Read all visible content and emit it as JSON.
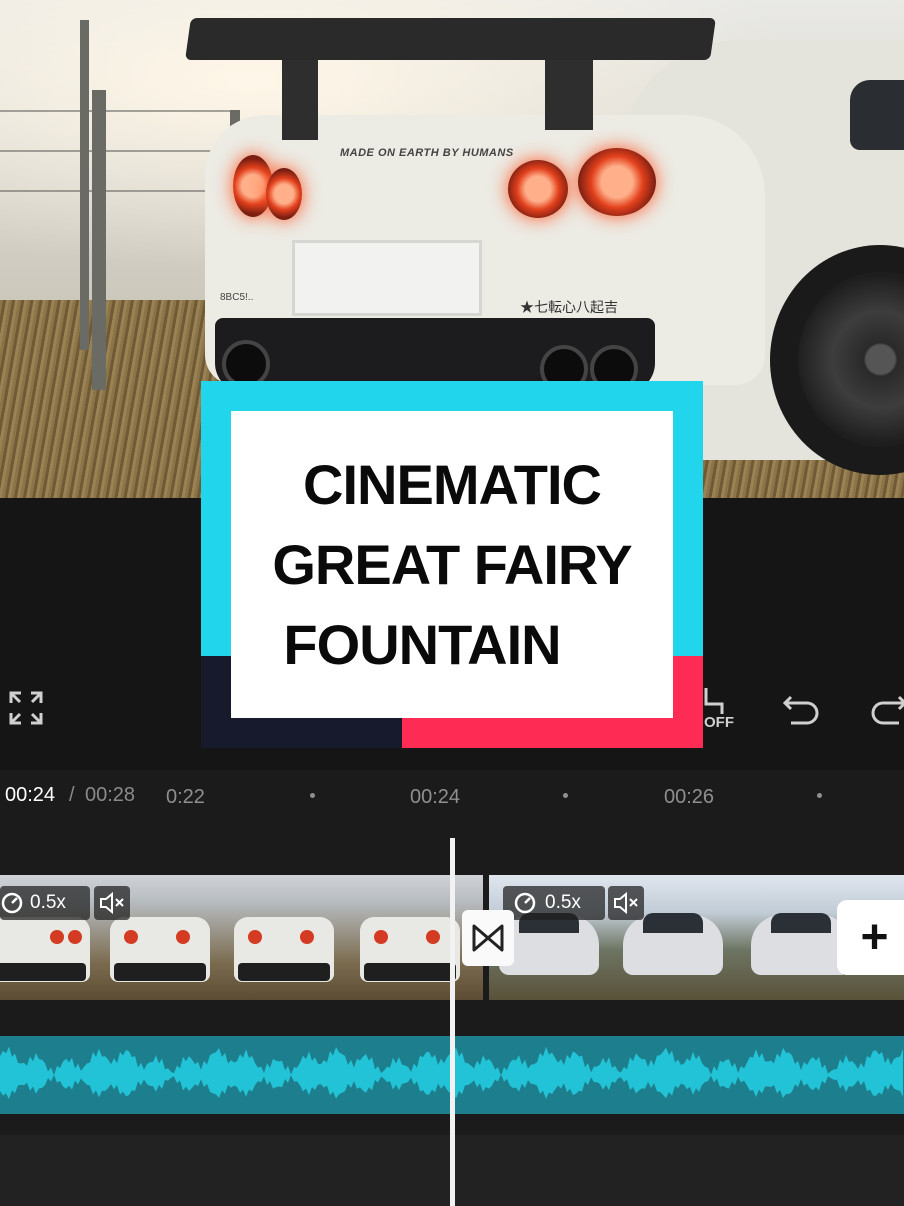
{
  "preview": {
    "badge_text": "MADE ON EARTH BY HUMANS",
    "left_mark": "8BC5!..",
    "side_text": "★七転心八起吉"
  },
  "overlay": {
    "lines": [
      "CINEMATIC",
      "GREAT FAIRY",
      "FOUNTAIN"
    ],
    "colors": {
      "cyan": "#20d5ec",
      "red": "#fe2c55",
      "navy": "#161a2c",
      "panel": "#ffffff"
    }
  },
  "toolbar": {
    "fullscreen_icon": "fullscreen-icon",
    "keyframe_icon": "keyframe-off-icon",
    "keyframe_state": "OFF",
    "undo_icon": "undo-icon",
    "redo_icon": "redo-icon"
  },
  "timeline": {
    "current": "00:24",
    "separator": "/",
    "total": "00:28",
    "ruler": [
      {
        "label": "0:22"
      },
      {
        "label": "00:24"
      },
      {
        "label": "00:26"
      }
    ],
    "clips": [
      {
        "speed": "0.5x",
        "speed_icon": "speed-gauge-icon",
        "mute_icon": "speaker-muted-icon"
      },
      {
        "speed": "0.5x",
        "speed_icon": "speed-gauge-icon",
        "mute_icon": "speaker-muted-icon"
      }
    ],
    "transition_icon": "bowtie-transition-icon",
    "add_label": "+",
    "audio_color": "#22c3d6"
  }
}
